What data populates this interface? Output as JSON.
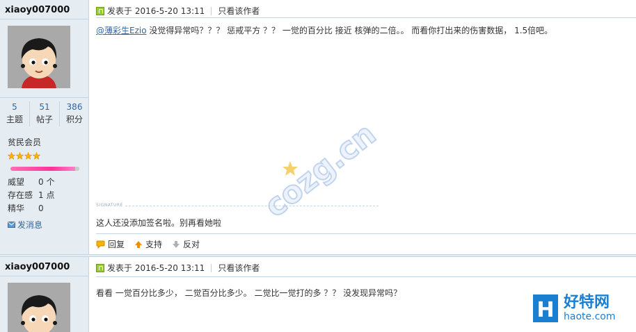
{
  "posts": [
    {
      "author": "xiaoy007000",
      "stats": [
        {
          "value": "5",
          "label": "主题"
        },
        {
          "value": "51",
          "label": "帖子"
        },
        {
          "value": "386",
          "label": "积分"
        }
      ],
      "group": "贫民会员",
      "star_count": 4,
      "fields": [
        {
          "key": "威望",
          "value": "0 个"
        },
        {
          "key": "存在感",
          "value": "1 点"
        },
        {
          "key": "精华",
          "value": "0"
        }
      ],
      "message_link": "发消息",
      "posted_at": "发表于 2016-5-20 13:11",
      "only_author": "只看该作者",
      "mention": "@薄彩生Ezio",
      "content": " 没觉得异常吗？？？ 惩戒平方 ？？ 一觉的百分比 接近 核弹的二倍。。 而看你打出来的伤害数据， 1.5倍吧。",
      "signature_label": "SIGNATURE",
      "signature": "这人还没添加签名啦。别再看她啦",
      "actions": {
        "reply": "回复",
        "support": "支持",
        "oppose": "反对"
      }
    },
    {
      "author": "xiaoy007000",
      "posted_at": "发表于 2016-5-20 13:11",
      "only_author": "只看该作者",
      "content": "看看  一觉百分比多少，    二觉百分比多少。   二觉比一觉打的多 ？？  没发现异常吗？"
    }
  ],
  "watermark": "cozg.cn",
  "site_logo": {
    "name": "好特网",
    "domain": "haote.com",
    "mark": "H"
  },
  "colors": {
    "sidebar_bg": "#e5edf2",
    "link": "#336699",
    "border": "#c2d5e3",
    "logo": "#1a7fd0"
  }
}
